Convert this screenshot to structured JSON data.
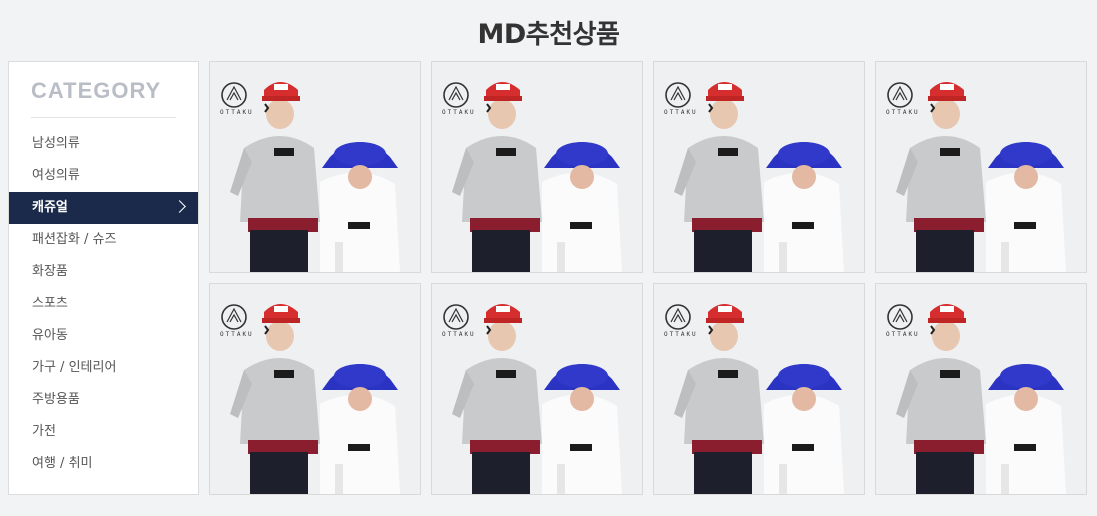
{
  "header": {
    "title_md": "MD",
    "title_rest": "추천상품"
  },
  "sidebar": {
    "heading": "CATEGORY",
    "items": [
      {
        "label": "남성의류",
        "active": false
      },
      {
        "label": "여성의류",
        "active": false
      },
      {
        "label": "캐쥬얼",
        "active": true
      },
      {
        "label": "패션잡화 / 슈즈",
        "active": false
      },
      {
        "label": "화장품",
        "active": false
      },
      {
        "label": "스포츠",
        "active": false
      },
      {
        "label": "유아동",
        "active": false
      },
      {
        "label": "가구 / 인테리어",
        "active": false
      },
      {
        "label": "주방용품",
        "active": false
      },
      {
        "label": "가전",
        "active": false
      },
      {
        "label": "여행 / 취미",
        "active": false
      }
    ]
  },
  "products": [
    {
      "brand": "OTTAKU"
    },
    {
      "brand": "OTTAKU"
    },
    {
      "brand": "OTTAKU"
    },
    {
      "brand": "OTTAKU"
    },
    {
      "brand": "OTTAKU"
    },
    {
      "brand": "OTTAKU"
    },
    {
      "brand": "OTTAKU"
    },
    {
      "brand": "OTTAKU"
    }
  ],
  "colors": {
    "active_bg": "#1b2a4b",
    "cap_red": "#d62e2e",
    "hat_blue": "#2b34c2"
  }
}
